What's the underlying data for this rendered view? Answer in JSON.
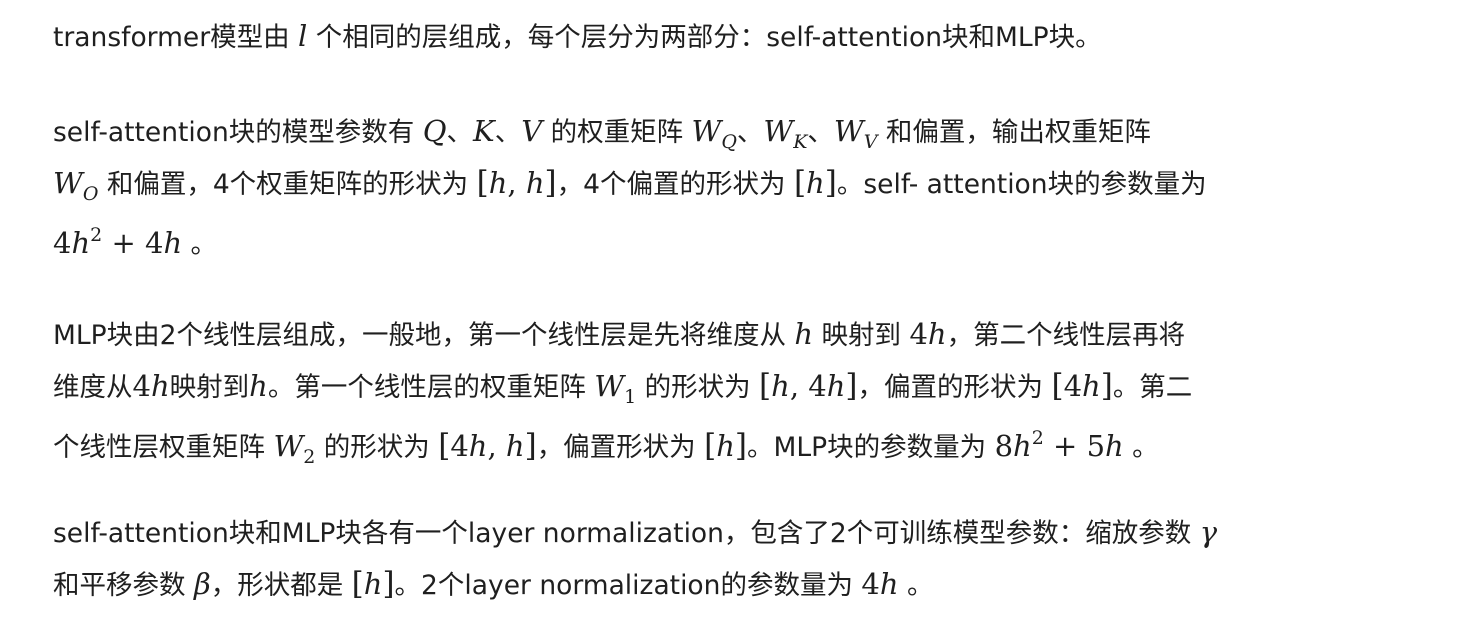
{
  "p1": {
    "t1": "transformer模型由 ",
    "m1": "l",
    "t2": " 个相同的层组成，每个层分为两部分：self-attention块和MLP块。"
  },
  "p2": {
    "l1": {
      "t1": "self-attention块的模型参数有 ",
      "Q": "Q",
      "s1": "、",
      "K": "K",
      "s2": "、",
      "V": "V",
      "t2": " 的权重矩阵 ",
      "W": "W",
      "sQ": "Q",
      "s3": "、",
      "W2": "W",
      "sK": "K",
      "s4": "、",
      "W3": "W",
      "sV": "V",
      "t3": " 和偏置，输出权重矩阵"
    },
    "l2": {
      "W": "W",
      "sO": "O",
      "t1": " 和偏置，4个权重矩阵的形状为 ",
      "b1o": "[",
      "h1": "h",
      "c": ", ",
      "h2": "h",
      "b1c": "]",
      "t2": "，4个偏置的形状为 ",
      "b2o": "[",
      "h3": "h",
      "b2c": "]",
      "t3": "。self- attention块的参数量为"
    },
    "l3": {
      "n1": "4",
      "h1": "h",
      "e": "2",
      "plus": " + ",
      "n2": "4",
      "h2": "h",
      "t1": " 。"
    }
  },
  "p3": {
    "l1": {
      "t1": "MLP块由2个线性层组成，一般地，第一个线性层是先将维度从 ",
      "h1": "h",
      "t2": " 映射到 ",
      "n1": "4",
      "h2": "h",
      "t3": "，第二个线性层再将"
    },
    "l2": {
      "t1": "维度从",
      "n1": "4",
      "h1": "h",
      "t2": "映射到",
      "h2": "h",
      "t3": "。第一个线性层的权重矩阵 ",
      "W": "W",
      "s1": "1",
      "t4": " 的形状为 ",
      "bo": "[",
      "h3": "h",
      "c": ", ",
      "n2": "4",
      "h4": "h",
      "bc": "]",
      "t5": "，偏置的形状为 ",
      "bo2": "[",
      "n3": "4",
      "h5": "h",
      "bc2": "]",
      "t6": "。第二"
    },
    "l3": {
      "t1": "个线性层权重矩阵 ",
      "W": "W",
      "s2": "2",
      "t2": " 的形状为 ",
      "bo": "[",
      "n1": "4",
      "h1": "h",
      "c": ", ",
      "h2": "h",
      "bc": "]",
      "t3": "，偏置形状为 ",
      "bo2": "[",
      "h3": "h",
      "bc2": "]",
      "t4": "。MLP块的参数量为 ",
      "n2": "8",
      "h4": "h",
      "e": "2",
      "plus": " + ",
      "n3": "5",
      "h5": "h",
      "t5": " 。"
    }
  },
  "p4": {
    "l1": {
      "t1": "self-attention块和MLP块各有一个layer normalization，包含了2个可训练模型参数：缩放参数 ",
      "g": "γ"
    },
    "l2": {
      "t1": "和平移参数 ",
      "b": "β",
      "t2": "，形状都是 ",
      "bo": "[",
      "h1": "h",
      "bc": "]",
      "t3": "。2个layer normalization的参数量为 ",
      "n1": "4",
      "h2": "h",
      "t4": " 。"
    }
  }
}
